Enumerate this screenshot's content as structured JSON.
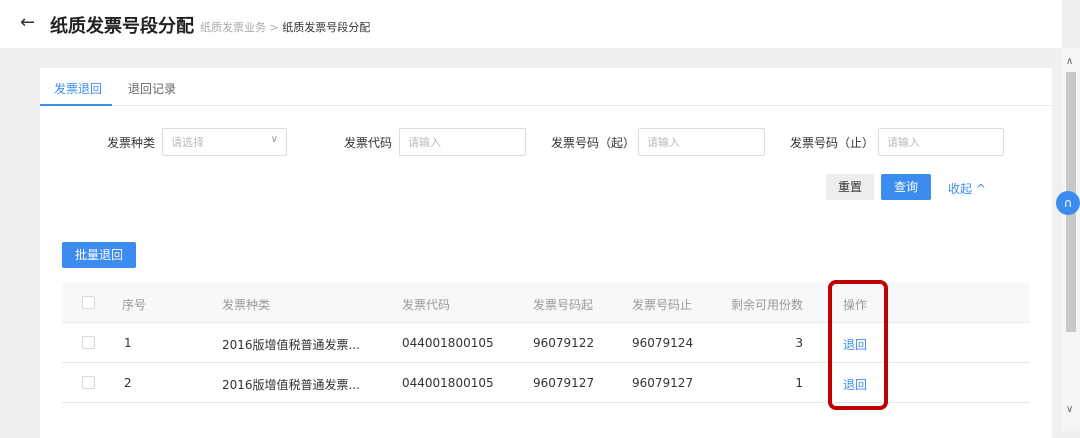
{
  "header": {
    "back_icon": "arrow-left",
    "title": "纸质发票号段分配",
    "breadcrumb": [
      "纸质发票业务",
      "纸质发票号段分配"
    ],
    "separator": ">"
  },
  "tabs": [
    "发票退回",
    "退回记录"
  ],
  "filters": [
    {
      "label": "发票种类",
      "placeholder": "请选择"
    },
    {
      "label": "发票代码",
      "placeholder": "请输入"
    },
    {
      "label": "发票号码（起）",
      "placeholder": "请输入"
    },
    {
      "label": "发票号码（止）",
      "placeholder": "请输入"
    }
  ],
  "buttons": {
    "reset": "重置",
    "query": "查询",
    "collapse": "收起 ^",
    "batch": "批量退回"
  },
  "table": {
    "columns": [
      "序号",
      "发票种类",
      "发票代码",
      "发票号码起",
      "发票号码止",
      "剩余可用份数",
      "操作"
    ],
    "rows": [
      {
        "no": "1",
        "type": "2016版增值税普通发票...",
        "code": "044001800105",
        "start": "96079122",
        "end": "96079124",
        "remain": "3",
        "action": "退回"
      },
      {
        "no": "2",
        "type": "2016版增值税普通发票...",
        "code": "044001800105",
        "start": "96079127",
        "end": "96079127",
        "remain": "1",
        "action": "退回"
      }
    ]
  },
  "colors": {
    "accent": "#3c8cf0",
    "highlight": "#c00000"
  }
}
